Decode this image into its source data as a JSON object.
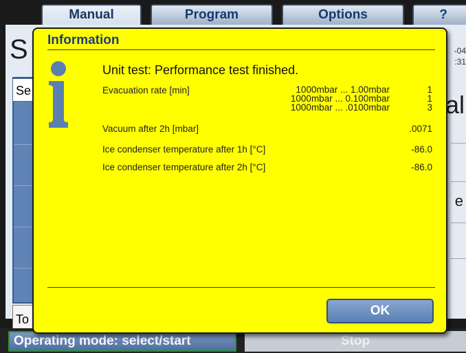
{
  "tabs": [
    {
      "label": "Manual"
    },
    {
      "label": "Program"
    },
    {
      "label": "Options"
    },
    {
      "label": "?"
    }
  ],
  "background": {
    "title_fragment": "S",
    "field_fragment": "Se",
    "tool_fragment": "To",
    "date_fragment_1": "-04",
    "date_fragment_2": ":31",
    "big_fragment": "al",
    "e_fragment": "e"
  },
  "dialog": {
    "title": "Information",
    "icon": "info-icon",
    "message": "Unit test: Performance test finished.",
    "evacuation": {
      "label": "Evacuation rate [min]",
      "ranges": [
        "1000mbar ... 1.00mbar",
        "1000mbar ... 0.100mbar",
        "1000mbar ... .0100mbar"
      ],
      "counts": [
        "1",
        "1",
        "3"
      ]
    },
    "vacuum": {
      "label": "Vacuum after 2h [mbar]",
      "value": ".0071"
    },
    "ice1": {
      "label": "Ice condenser temperature after 1h [°C]",
      "value": "-86.0"
    },
    "ice2": {
      "label": "Ice condenser temperature after 2h [°C]",
      "value": "-86.0"
    },
    "ok_label": "OK"
  },
  "statusbar": {
    "mode_label": "Operating mode: select/start",
    "stop_label": "Stop"
  },
  "colors": {
    "dialog_bg": "#ffff00",
    "title_color": "#1e3d78",
    "button_blue": "#6f90c0",
    "mode_border": "#2f8f3a"
  }
}
